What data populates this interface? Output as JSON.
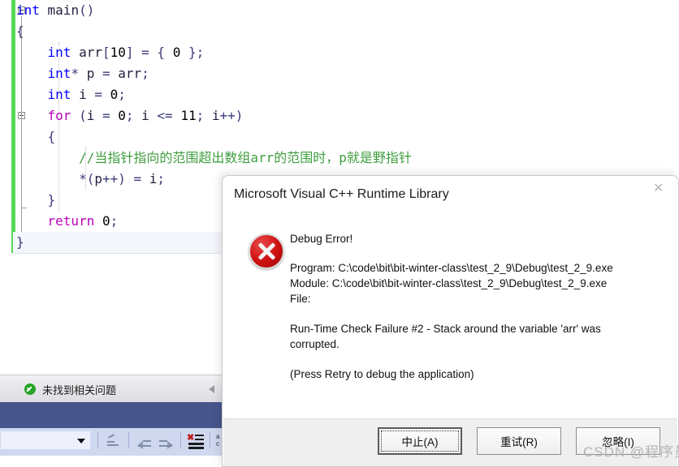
{
  "editor": {
    "lines": [
      [
        {
          "t": "int",
          "c": "kw"
        },
        {
          "t": " main",
          "c": "id"
        },
        {
          "t": "()",
          "c": "punc"
        }
      ],
      [
        {
          "t": "{",
          "c": "punc"
        }
      ],
      [
        {
          "t": "    ",
          "c": "id"
        },
        {
          "t": "int",
          "c": "kw"
        },
        {
          "t": " arr",
          "c": "id"
        },
        {
          "t": "[",
          "c": "punc"
        },
        {
          "t": "10",
          "c": "num"
        },
        {
          "t": "]",
          "c": "punc"
        },
        {
          "t": " = ",
          "c": "punc"
        },
        {
          "t": "{ ",
          "c": "punc"
        },
        {
          "t": "0",
          "c": "num"
        },
        {
          "t": " }",
          "c": "punc"
        },
        {
          "t": ";",
          "c": "punc"
        }
      ],
      [
        {
          "t": "    ",
          "c": "id"
        },
        {
          "t": "int",
          "c": "kw"
        },
        {
          "t": "*",
          "c": "punc"
        },
        {
          "t": " p ",
          "c": "id"
        },
        {
          "t": "= ",
          "c": "punc"
        },
        {
          "t": "arr",
          "c": "id"
        },
        {
          "t": ";",
          "c": "punc"
        }
      ],
      [
        {
          "t": "    ",
          "c": "id"
        },
        {
          "t": "int",
          "c": "kw"
        },
        {
          "t": " i ",
          "c": "id"
        },
        {
          "t": "= ",
          "c": "punc"
        },
        {
          "t": "0",
          "c": "num"
        },
        {
          "t": ";",
          "c": "punc"
        }
      ],
      [
        {
          "t": "    ",
          "c": "id"
        },
        {
          "t": "for",
          "c": "kw2"
        },
        {
          "t": " (",
          "c": "punc"
        },
        {
          "t": "i ",
          "c": "id"
        },
        {
          "t": "= ",
          "c": "punc"
        },
        {
          "t": "0",
          "c": "num"
        },
        {
          "t": "; ",
          "c": "punc"
        },
        {
          "t": "i ",
          "c": "id"
        },
        {
          "t": "<= ",
          "c": "punc"
        },
        {
          "t": "11",
          "c": "num"
        },
        {
          "t": "; ",
          "c": "punc"
        },
        {
          "t": "i",
          "c": "id"
        },
        {
          "t": "++)",
          "c": "punc"
        }
      ],
      [
        {
          "t": "    ",
          "c": "id"
        },
        {
          "t": "{",
          "c": "punc"
        }
      ],
      [
        {
          "t": "        ",
          "c": "id"
        },
        {
          "t": "//当指针指向的范围超出数组arr的范围时，p就是野指针",
          "c": "cmt"
        }
      ],
      [
        {
          "t": "        ",
          "c": "id"
        },
        {
          "t": "*(",
          "c": "punc"
        },
        {
          "t": "p",
          "c": "id"
        },
        {
          "t": "++) ",
          "c": "punc"
        },
        {
          "t": "= ",
          "c": "punc"
        },
        {
          "t": "i",
          "c": "id"
        },
        {
          "t": ";",
          "c": "punc"
        }
      ],
      [
        {
          "t": "    ",
          "c": "id"
        },
        {
          "t": "}",
          "c": "punc"
        }
      ],
      [
        {
          "t": "    ",
          "c": "id"
        },
        {
          "t": "return",
          "c": "kw2"
        },
        {
          "t": " ",
          "c": "id"
        },
        {
          "t": "0",
          "c": "num"
        },
        {
          "t": ";",
          "c": "punc"
        }
      ],
      [
        {
          "t": "}",
          "c": "punc"
        }
      ]
    ]
  },
  "statusbar": {
    "text": "未找到相关问题"
  },
  "bottombar": {
    "combo_value": "",
    "icons": [
      "undo-indent-icon",
      "outdent-icon",
      "indent-icon",
      "clear-list-icon",
      "match-case-icon"
    ]
  },
  "dialog": {
    "title": "Microsoft Visual C++ Runtime Library",
    "close_label": "✕",
    "heading": "Debug Error!",
    "program_line": "Program: C:\\code\\bit\\bit-winter-class\\test_2_9\\Debug\\test_2_9.exe",
    "module_line": "Module: C:\\code\\bit\\bit-winter-class\\test_2_9\\Debug\\test_2_9.exe",
    "file_line": "File:",
    "message": "Run-Time Check Failure #2 - Stack around the variable 'arr' was corrupted.",
    "hint": "(Press Retry to debug the application)",
    "buttons": {
      "abort": "中止(A)",
      "retry": "重试(R)",
      "ignore": "忽略(I)"
    }
  },
  "watermark": {
    "text": "CSDN @程序员佳豰"
  },
  "colors": {
    "keyword_blue": "#0000ff",
    "keyword_purple": "#b800b8",
    "comment_green": "#3f9e3f",
    "change_bar_green": "#57d957",
    "error_red": "#cf1111",
    "status_ok_green": "#27a327",
    "blue_band": "#46558c",
    "toolbar_blue": "#cfd8ee"
  }
}
